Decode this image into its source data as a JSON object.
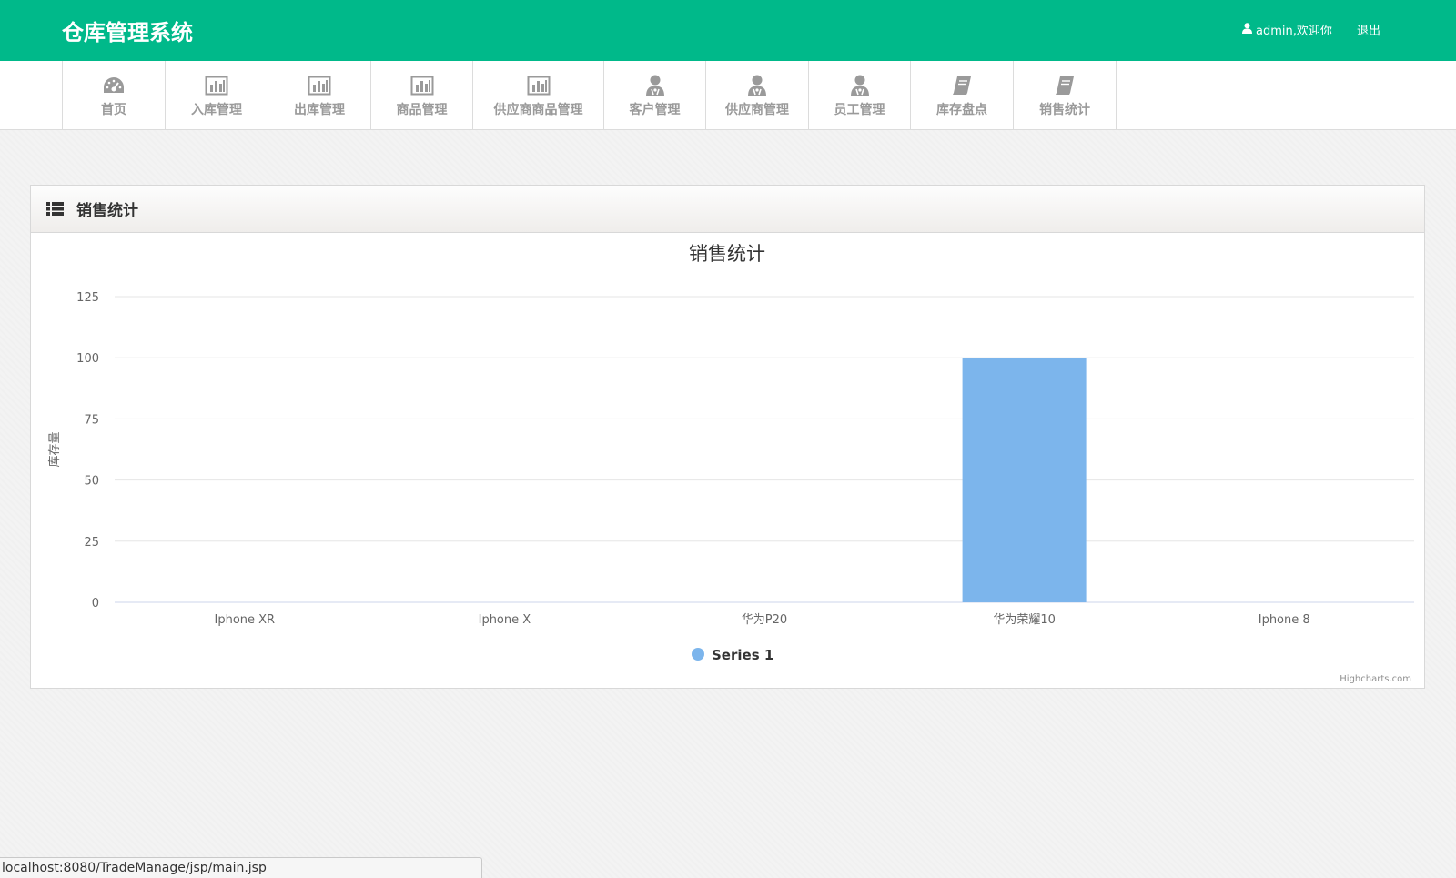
{
  "header": {
    "brand": "仓库管理系统",
    "user_greeting": "admin,欢迎你",
    "logout_label": "退出",
    "bg_color": "#00b98a"
  },
  "nav": {
    "items": [
      {
        "label": "首页",
        "icon": "dashboard-icon"
      },
      {
        "label": "入库管理",
        "icon": "bar-chart-icon"
      },
      {
        "label": "出库管理",
        "icon": "bar-chart-icon"
      },
      {
        "label": "商品管理",
        "icon": "bar-chart-icon"
      },
      {
        "label": "供应商商品管理",
        "icon": "bar-chart-icon"
      },
      {
        "label": "客户管理",
        "icon": "user-icon"
      },
      {
        "label": "供应商管理",
        "icon": "user-icon"
      },
      {
        "label": "员工管理",
        "icon": "user-icon"
      },
      {
        "label": "库存盘点",
        "icon": "book-icon"
      },
      {
        "label": "销售统计",
        "icon": "book-icon"
      }
    ]
  },
  "panel": {
    "title": "销售统计",
    "icon": "list-icon"
  },
  "chart_data": {
    "type": "bar",
    "title": "销售统计",
    "ylabel": "库存量",
    "xlabel": "",
    "categories": [
      "Iphone XR",
      "Iphone X",
      "华为P20",
      "华为荣耀10",
      "Iphone 8"
    ],
    "series": [
      {
        "name": "Series 1",
        "values": [
          0,
          0,
          0,
          100,
          0
        ],
        "color": "#7cb5ec"
      }
    ],
    "ylim": [
      0,
      125
    ],
    "yticks": [
      0,
      25,
      50,
      75,
      100,
      125
    ],
    "grid": true,
    "legend": "bottom-center",
    "credit": "Highcharts.com"
  },
  "statusbar": {
    "url": "localhost:8080/TradeManage/jsp/main.jsp"
  }
}
